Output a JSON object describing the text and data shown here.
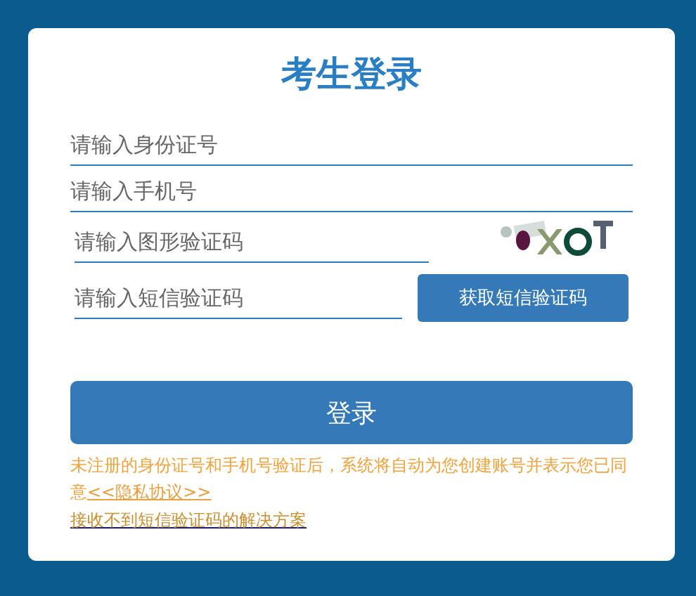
{
  "title": "考生登录",
  "fields": [
    {
      "placeholder": "请输入身份证号",
      "kind": "full"
    },
    {
      "placeholder": "请输入手机号",
      "kind": "full"
    },
    {
      "placeholder": "请输入图形验证码",
      "kind": "captcha"
    },
    {
      "placeholder": "请输入短信验证码",
      "kind": "sms",
      "button": "获取短信验证码"
    }
  ],
  "login_button": "登录",
  "notice": {
    "text": "未注册的身份证号和手机号验证后，系统将自动为您创建账号并表示您已同意",
    "link": "<<隐私协议>>"
  },
  "help_link": "接收不到短信验证码的解决方案"
}
